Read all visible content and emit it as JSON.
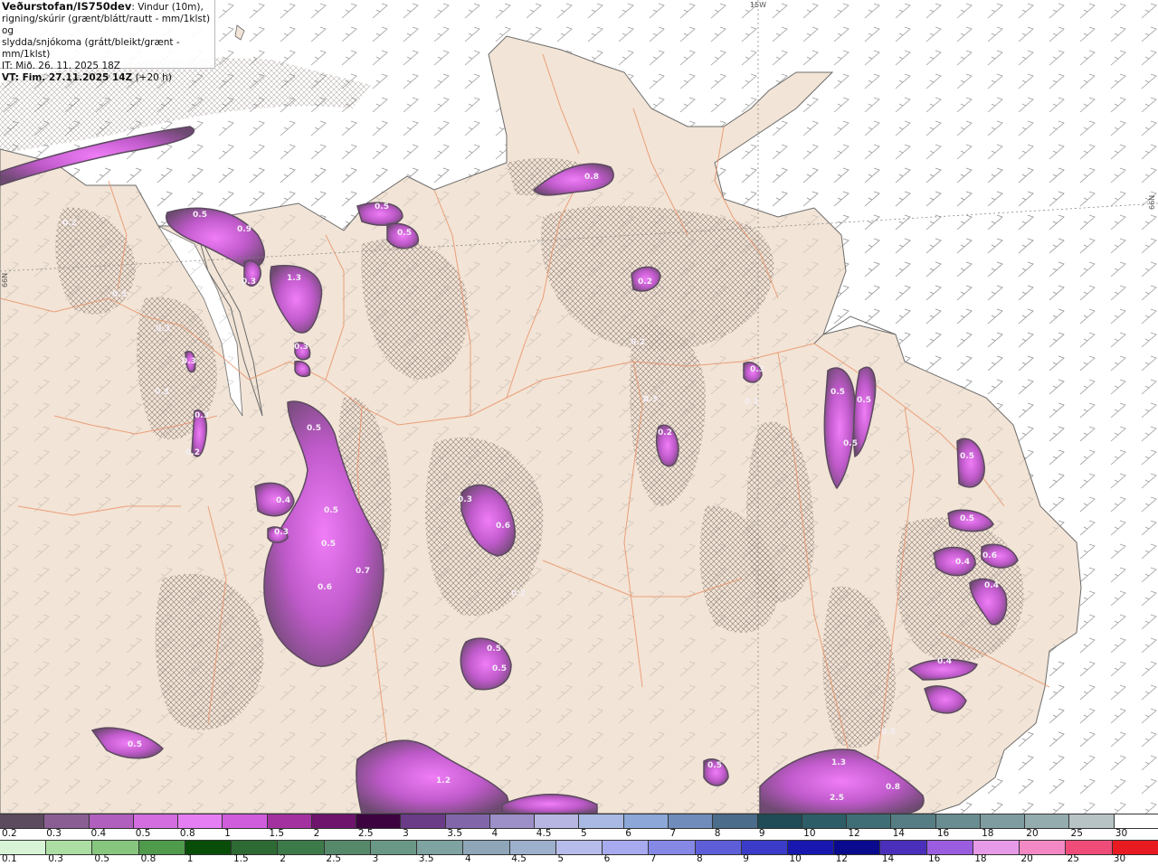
{
  "header": {
    "title": "Veðurstofan/IS750dev",
    "title_suffix": ": Vindur (10m),",
    "line2": "rigning/skúrir (grænt/blátt/rautt - mm/1klst) og",
    "line3": "slydda/snjókoma (grátt/bleikt/grænt - mm/1klst)",
    "it": "IT: Mið. 26. 11. 2025 18Z",
    "vt": "VT: Fim. 27.11.2025 14Z",
    "vt_suffix": " (+20 h)"
  },
  "map": {
    "grid_labels": {
      "top": "15W",
      "left": "66N",
      "right": "66N"
    },
    "colors": {
      "sea": "#ffffff",
      "land": "#f2e4d6",
      "roads": "#e9946a",
      "hatch": "#7d6e66"
    },
    "precip_labels": [
      "0.5",
      "0.9",
      "0.3",
      "1.3",
      "0.3",
      "0.5",
      "0.5",
      "0.8",
      "0.2",
      "0.2",
      "0.3",
      "0.3",
      "0.3",
      "0.3",
      "0.2",
      "0.3",
      "0.5",
      "0.4",
      "0.3",
      "0.5",
      "0.5",
      "0.6",
      "0.7",
      "0.3",
      "0.6",
      "0.2",
      "0.2",
      "0.3",
      "0.3",
      "0.2",
      "0.5",
      "0.5",
      "0.5",
      "0.5",
      "0.5",
      "0.4",
      "0.6",
      "0.4",
      "0.5",
      "0.4",
      "0.2",
      "0.5",
      "1.2",
      "0.5",
      "1.3",
      "2.5",
      "0.8",
      "0.5",
      "0.5"
    ]
  },
  "legend": {
    "snow": {
      "labels": [
        "0.2",
        "0.3",
        "0.4",
        "0.5",
        "0.8",
        "1",
        "1.5",
        "2",
        "2.5",
        "3",
        "3.5",
        "4",
        "4.5",
        "5",
        "6",
        "7",
        "8",
        "9",
        "10",
        "12",
        "14",
        "16",
        "18",
        "20",
        "25",
        "30"
      ],
      "colors": [
        "#5c4a5f",
        "#8a5e93",
        "#b05fbf",
        "#d36de0",
        "#e67ef3",
        "#cf5ddc",
        "#a3319f",
        "#6e146c",
        "#3d0340",
        "#6a3b86",
        "#8266aa",
        "#9d8fc8",
        "#b7b5e2",
        "#a9b9e4",
        "#8ca7d8",
        "#6f8cbb",
        "#4b6c8b",
        "#1f4c57",
        "#2d5d66",
        "#3f6e76",
        "#557d83",
        "#6a8d92",
        "#7f9ca0",
        "#95acaf",
        "#b7c3c4",
        "#ffffff"
      ]
    },
    "rain": {
      "labels": [
        "0.1",
        "0.3",
        "0.5",
        "0.8",
        "1",
        "1.5",
        "2",
        "2.5",
        "3",
        "3.5",
        "4",
        "4.5",
        "5",
        "6",
        "7",
        "8",
        "9",
        "10",
        "12",
        "14",
        "16",
        "18",
        "20",
        "25",
        "30"
      ],
      "colors": [
        "#d7f5d6",
        "#acdea3",
        "#86c67e",
        "#4f9a4b",
        "#084e08",
        "#2e6a33",
        "#3d7a4a",
        "#56886a",
        "#6a9886",
        "#7fa3a0",
        "#8ea6b8",
        "#9db0cc",
        "#b7bdea",
        "#a8aaf0",
        "#8688e6",
        "#5d5ed8",
        "#3a3bc8",
        "#1818b0",
        "#0a0a8e",
        "#4a2fba",
        "#9b5de0",
        "#e79ae8",
        "#f389c4",
        "#f04c7a",
        "#e81b22"
      ]
    }
  }
}
